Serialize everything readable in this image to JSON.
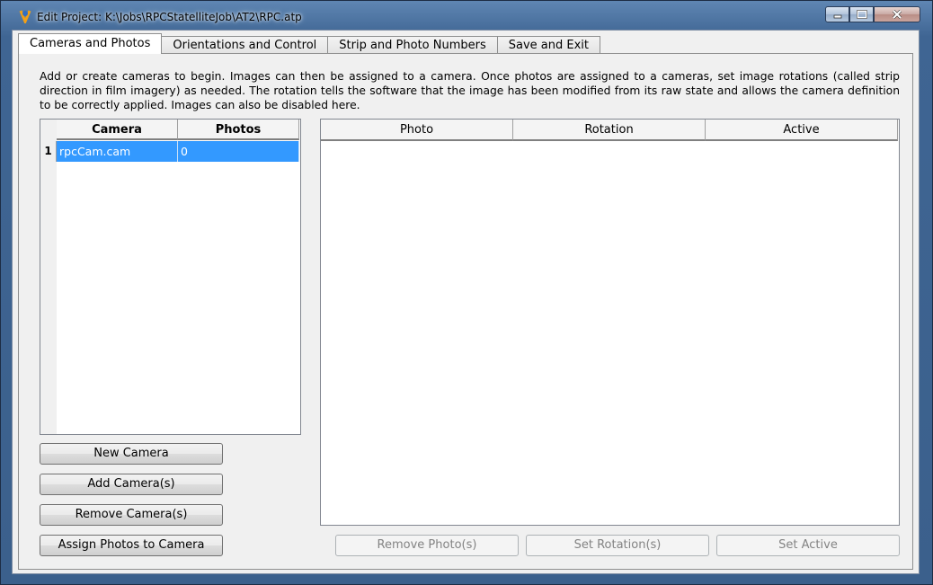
{
  "window": {
    "title": "Edit Project:  K:\\Jobs\\RPCStatelliteJob\\AT2\\RPC.atp",
    "icon": "app-logo-icon",
    "controls": [
      "minimize-icon",
      "maximize-icon",
      "close-icon"
    ]
  },
  "tabs": [
    {
      "label": "Cameras and Photos",
      "active": true
    },
    {
      "label": "Orientations and Control",
      "active": false
    },
    {
      "label": "Strip and Photo Numbers",
      "active": false
    },
    {
      "label": "Save and Exit",
      "active": false
    }
  ],
  "description": "Add or create cameras to begin. Images can then be assigned to a camera. Once photos are assigned to a cameras, set image rotations (called strip direction in film imagery) as needed. The rotation tells the software that the image has been modified from its raw state and allows the camera definition to be correctly applied. Images can also be disabled here.",
  "camera_grid": {
    "columns": [
      "Camera",
      "Photos"
    ],
    "rows": [
      {
        "num": "1",
        "camera": "rpcCam.cam",
        "photos": "0",
        "selected": true
      }
    ]
  },
  "camera_buttons": {
    "new": "New Camera",
    "add": "Add Camera(s)",
    "remove": "Remove Camera(s)",
    "assign": "Assign Photos to Camera"
  },
  "photo_grid": {
    "columns": [
      "Photo",
      "Rotation",
      "Active"
    ],
    "rows": []
  },
  "photo_buttons": {
    "remove": "Remove Photo(s)",
    "rotation": "Set Rotation(s)",
    "active": "Set Active"
  },
  "colors": {
    "selection": "#3399ff",
    "title_bar": "#3f6593",
    "disabled_text": "#838383"
  }
}
